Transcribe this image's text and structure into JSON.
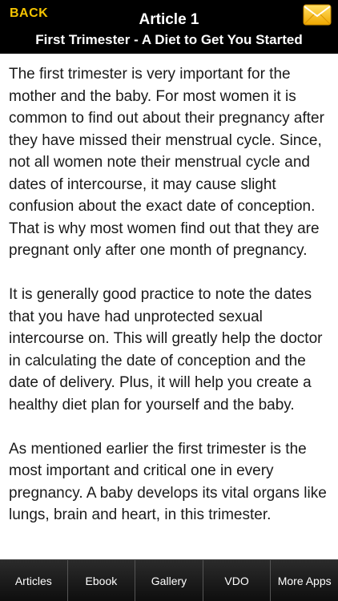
{
  "header": {
    "back_label": "BACK",
    "title": "Article 1",
    "subtitle": "First Trimester - A Diet to Get You Started",
    "mail_icon": "envelope-icon",
    "mail_icon_color": "#f5c400"
  },
  "article": {
    "paragraphs": [
      "The first trimester is very important for the mother and the baby. For most women it is common to find out about their pregnancy after they have missed their menstrual cycle. Since, not all women note their menstrual cycle and dates of intercourse, it may cause slight confusion about the exact date of conception. That is why most women find out that they are pregnant only after one month of pregnancy.",
      "It is generally good practice to note the dates that you have had unprotected sexual intercourse on. This will greatly help the doctor in calculating the date of conception and the date of delivery. Plus, it will help you create a healthy diet plan for yourself and the baby.",
      "As mentioned earlier the first trimester is the most important and critical one in every pregnancy. A baby develops its vital organs like lungs, brain and heart, in this trimester."
    ]
  },
  "tabs": [
    {
      "label": "Articles"
    },
    {
      "label": "Ebook"
    },
    {
      "label": "Gallery"
    },
    {
      "label": "VDO"
    },
    {
      "label": "More Apps"
    }
  ]
}
